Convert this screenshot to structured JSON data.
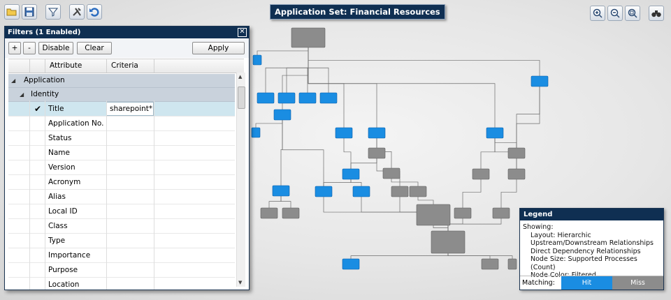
{
  "title": "Application Set: Financial Resources",
  "colors": {
    "hit": "#1a8de2",
    "miss": "#8c8c8c",
    "header": "#0f2f52",
    "group": "#c9d2dc",
    "selected_row": "#cfe6ef"
  },
  "toolbar": {
    "icons": [
      "open-folder-icon",
      "save-icon",
      "filter-icon",
      "tools-icon",
      "undo-icon"
    ],
    "right_icons": [
      "zoom-in-icon",
      "zoom-out-icon",
      "zoom-fit-icon",
      "binoculars-icon"
    ]
  },
  "filters": {
    "title": "Filters",
    "enabled_count": "(1 Enabled)",
    "buttons": {
      "add": "+",
      "remove": "-",
      "disable": "Disable",
      "clear": "Clear",
      "apply": "Apply"
    },
    "columns": {
      "attribute": "Attribute",
      "criteria": "Criteria"
    },
    "groups": {
      "application": "Application",
      "identity": "Identity"
    },
    "rows": [
      {
        "attribute": "Title",
        "criteria": "sharepoint*",
        "checked": "✔"
      },
      {
        "attribute": "Application No.",
        "criteria": ""
      },
      {
        "attribute": "Status",
        "criteria": ""
      },
      {
        "attribute": "Name",
        "criteria": ""
      },
      {
        "attribute": "Version",
        "criteria": ""
      },
      {
        "attribute": "Acronym",
        "criteria": ""
      },
      {
        "attribute": "Alias",
        "criteria": ""
      },
      {
        "attribute": "Local ID",
        "criteria": ""
      },
      {
        "attribute": "Class",
        "criteria": ""
      },
      {
        "attribute": "Type",
        "criteria": ""
      },
      {
        "attribute": "Importance",
        "criteria": ""
      },
      {
        "attribute": "Purpose",
        "criteria": ""
      },
      {
        "attribute": "Location",
        "criteria": ""
      }
    ]
  },
  "legend": {
    "title": "Legend",
    "showing_label": "Showing:",
    "lines": [
      "Layout: Hierarchic",
      "Upstream/Downstream Relationships",
      "Direct Dependency Relationships",
      "Node Size: Supported Processes (Count)",
      "Node Color: Filtered"
    ],
    "matching_label": "Matching:",
    "hit": "Hit",
    "miss": "Miss"
  }
}
